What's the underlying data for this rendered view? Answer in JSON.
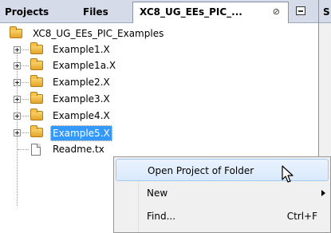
{
  "tabs": [
    {
      "label": "Projects"
    },
    {
      "label": "Files"
    },
    {
      "label": "XC8_UG_EEs_PIC_...",
      "close_glyph": "⊘"
    }
  ],
  "right_panel_tab_initial": "S",
  "tree": {
    "root": {
      "label": "XC8_UG_EEs_PIC_Examples",
      "icon": "folder-icon"
    },
    "children": [
      {
        "label": "Example1.X",
        "icon": "folder-icon"
      },
      {
        "label": "Example1a.X",
        "icon": "folder-icon"
      },
      {
        "label": "Example2.X",
        "icon": "folder-icon"
      },
      {
        "label": "Example3.X",
        "icon": "folder-icon"
      },
      {
        "label": "Example4.X",
        "icon": "folder-icon"
      },
      {
        "label": "Example5.X",
        "icon": "folder-icon",
        "selected": true
      },
      {
        "label": "Readme.tx",
        "icon": "file-icon"
      }
    ]
  },
  "context_menu": {
    "items": [
      {
        "label": "Open Project of Folder",
        "hovered": true
      },
      {
        "label": "New",
        "submenu": true
      },
      {
        "label": "Find...",
        "shortcut": "Ctrl+F"
      }
    ]
  },
  "colors": {
    "selection": "#3399ff",
    "tab_strip": "#d6dbe9",
    "menu_background": "#f0f0f0"
  }
}
